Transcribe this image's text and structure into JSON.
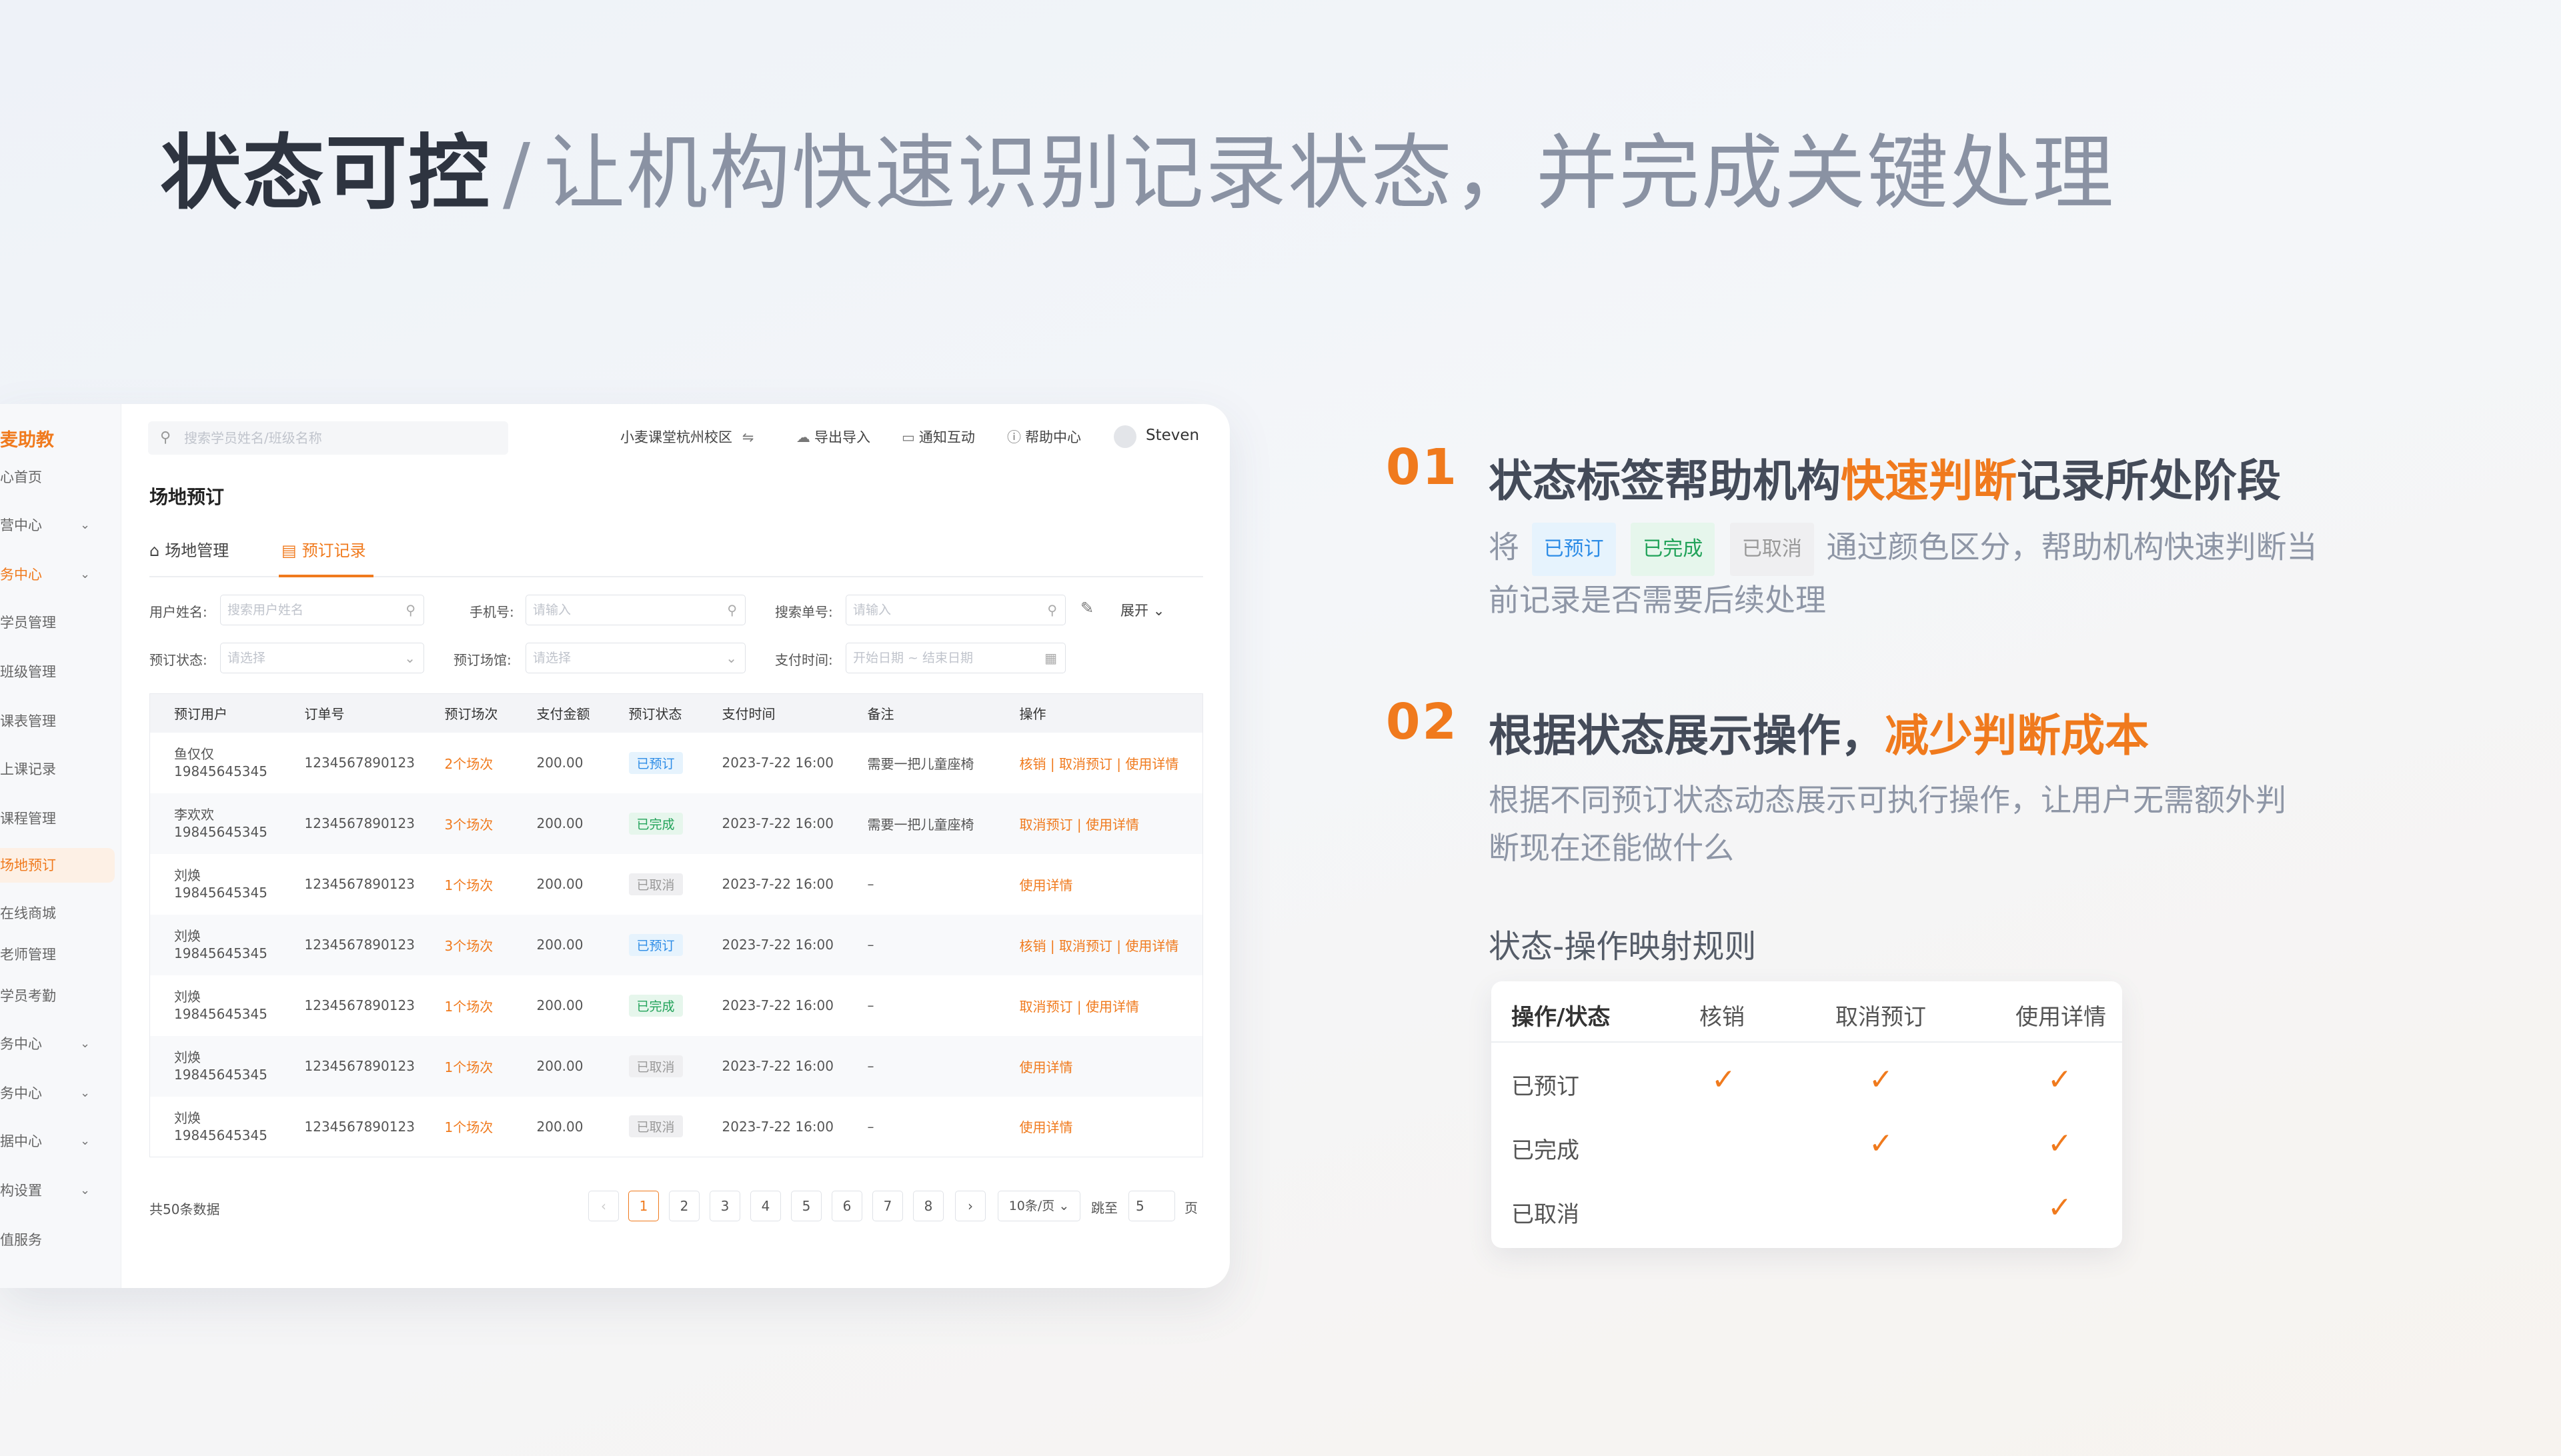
{
  "headline": {
    "bold": "状态可控",
    "slash": "/",
    "sub": "让机构快速识别记录状态，并完成关键处理"
  },
  "colors": {
    "accent": "#f07a1d",
    "booked": "#2d8ce6",
    "done": "#22a35a",
    "cancelled": "#999999"
  },
  "sidebar": {
    "logo": "麦助教",
    "items": [
      {
        "label": "心首页",
        "chevron": false
      },
      {
        "label": "营中心",
        "chevron": true
      },
      {
        "label": "务中心",
        "chevron": true,
        "highlight": true
      },
      {
        "label": "学员管理",
        "chevron": false
      },
      {
        "label": "班级管理",
        "chevron": false
      },
      {
        "label": "课表管理",
        "chevron": false
      },
      {
        "label": "上课记录",
        "chevron": false
      },
      {
        "label": "课程管理",
        "chevron": false
      },
      {
        "label": "场地预订",
        "chevron": false,
        "active": true
      },
      {
        "label": "在线商城",
        "chevron": false
      },
      {
        "label": "老师管理",
        "chevron": false
      },
      {
        "label": "学员考勤",
        "chevron": false
      },
      {
        "label": "务中心",
        "chevron": true
      },
      {
        "label": "务中心",
        "chevron": true
      },
      {
        "label": "据中心",
        "chevron": true
      },
      {
        "label": "构设置",
        "chevron": true
      },
      {
        "label": "值服务",
        "chevron": false
      }
    ]
  },
  "topbar": {
    "search_placeholder": "搜索学员姓名/班级名称",
    "campus": "小麦课堂杭州校区",
    "campus_icon": "⇋",
    "export": "导出导入",
    "notify": "通知互动",
    "help": "帮助中心",
    "user": "Steven"
  },
  "page": {
    "title": "场地预订",
    "tabs": [
      "场地管理",
      "预订记录"
    ]
  },
  "filters": {
    "user_label": "用户姓名:",
    "user_ph": "搜索用户姓名",
    "phone_label": "手机号:",
    "phone_ph": "请输入",
    "order_label": "搜索单号:",
    "order_ph": "请输入",
    "status_label": "预订状态:",
    "status_ph": "请选择",
    "venue_label": "预订场馆:",
    "venue_ph": "请选择",
    "time_label": "支付时间:",
    "time_ph": "开始日期 ~ 结束日期",
    "expand": "展开"
  },
  "table": {
    "headers": [
      "预订用户",
      "订单号",
      "预订场次",
      "支付金额",
      "预订状态",
      "支付时间",
      "备注",
      "操作"
    ],
    "rows": [
      {
        "name": "鱼仅仅",
        "phone": "19845645345",
        "order": "1234567890123",
        "count": "2个场次",
        "amount": "200.00",
        "status": "已预订",
        "status_type": "booked",
        "time": "2023-7-22 16:00",
        "note": "需要一把儿童座椅",
        "ops": "核销 | 取消预订 | 使用详情"
      },
      {
        "name": "李欢欢",
        "phone": "19845645345",
        "order": "1234567890123",
        "count": "3个场次",
        "amount": "200.00",
        "status": "已完成",
        "status_type": "done",
        "time": "2023-7-22 16:00",
        "note": "需要一把儿童座椅",
        "ops": "取消预订 | 使用详情"
      },
      {
        "name": "刘焕",
        "phone": "19845645345",
        "order": "1234567890123",
        "count": "1个场次",
        "amount": "200.00",
        "status": "已取消",
        "status_type": "cancel",
        "time": "2023-7-22 16:00",
        "note": "–",
        "ops": "使用详情"
      },
      {
        "name": "刘焕",
        "phone": "19845645345",
        "order": "1234567890123",
        "count": "3个场次",
        "amount": "200.00",
        "status": "已预订",
        "status_type": "booked",
        "time": "2023-7-22 16:00",
        "note": "–",
        "ops": "核销 | 取消预订 | 使用详情"
      },
      {
        "name": "刘焕",
        "phone": "19845645345",
        "order": "1234567890123",
        "count": "1个场次",
        "amount": "200.00",
        "status": "已完成",
        "status_type": "done",
        "time": "2023-7-22 16:00",
        "note": "–",
        "ops": "取消预订 | 使用详情"
      },
      {
        "name": "刘焕",
        "phone": "19845645345",
        "order": "1234567890123",
        "count": "1个场次",
        "amount": "200.00",
        "status": "已取消",
        "status_type": "cancel",
        "time": "2023-7-22 16:00",
        "note": "–",
        "ops": "使用详情"
      },
      {
        "name": "刘焕",
        "phone": "19845645345",
        "order": "1234567890123",
        "count": "1个场次",
        "amount": "200.00",
        "status": "已取消",
        "status_type": "cancel",
        "time": "2023-7-22 16:00",
        "note": "–",
        "ops": "使用详情"
      }
    ]
  },
  "pagination": {
    "total": "共50条数据",
    "prev": "‹",
    "next": "›",
    "pages": [
      "1",
      "2",
      "3",
      "4",
      "5",
      "6",
      "7",
      "8"
    ],
    "current": "1",
    "page_size": "10条/页",
    "jump_label": "跳至",
    "jump_value": "5",
    "page_unit": "页"
  },
  "points": [
    {
      "num": "01",
      "title_pre": "状态标签帮助机构",
      "title_hl": "快速判断",
      "title_post": "记录所处阶段",
      "desc_pre": "将",
      "badges": [
        "已预订",
        "已完成",
        "已取消"
      ],
      "desc_line1": "通过颜色区分，帮助机构快速判断当",
      "desc_line2": "前记录是否需要后续处理"
    },
    {
      "num": "02",
      "title_pre": "根据状态展示操作，",
      "title_hl": "减少判断成本",
      "desc_line1": "根据不同预订状态动态展示可执行操作，让用户无需额外判",
      "desc_line2": "断现在还能做什么"
    }
  ],
  "mapping": {
    "title": "状态-操作映射规则",
    "headers": [
      "操作/状态",
      "核销",
      "取消预订",
      "使用详情"
    ],
    "rows": [
      {
        "label": "已预订",
        "checks": [
          true,
          true,
          true
        ]
      },
      {
        "label": "已完成",
        "checks": [
          false,
          true,
          true
        ]
      },
      {
        "label": "已取消",
        "checks": [
          false,
          false,
          true
        ]
      }
    ],
    "check_icon": "✓"
  }
}
